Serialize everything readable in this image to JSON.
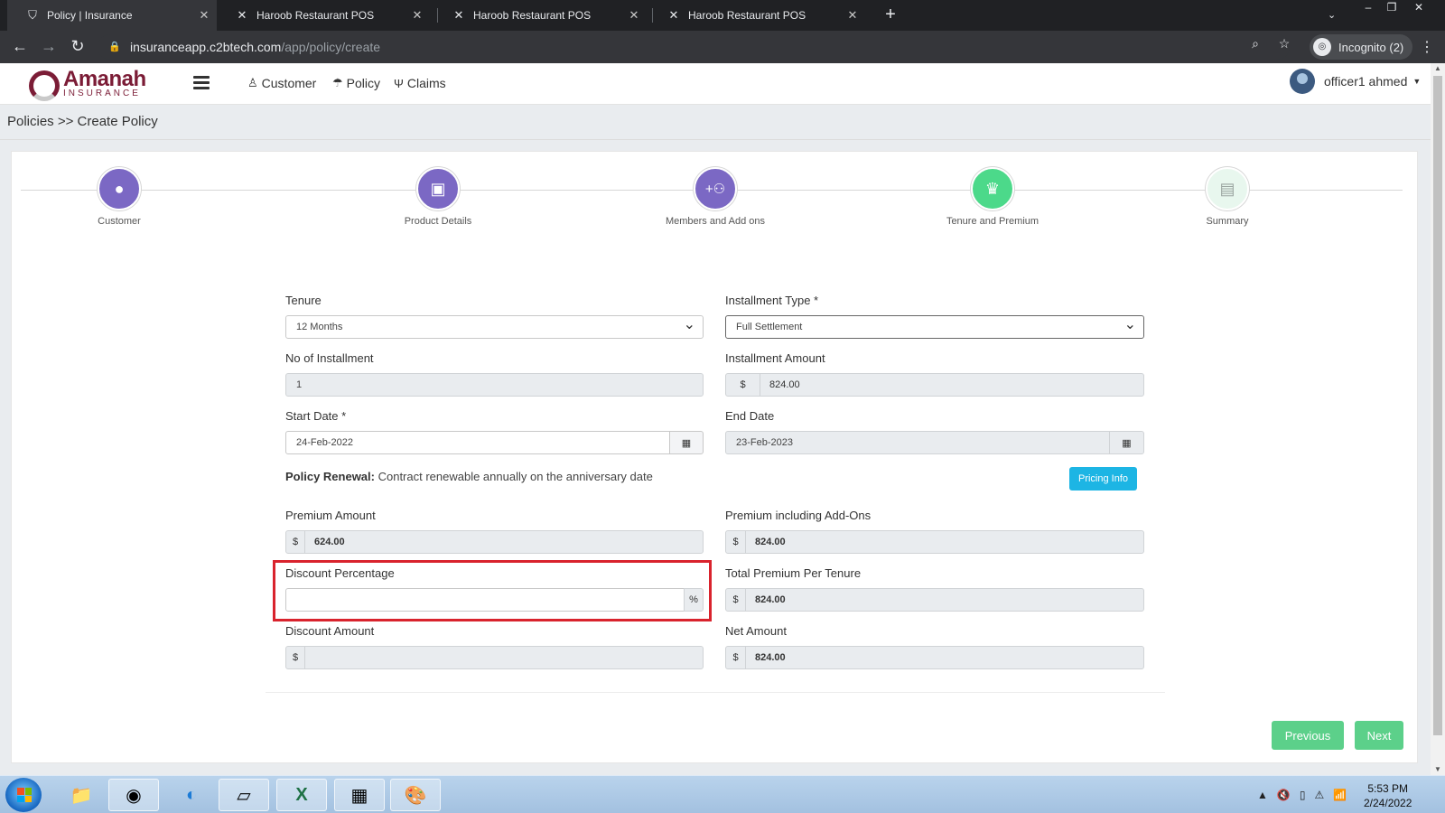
{
  "browser": {
    "tabs": [
      {
        "title": "Policy | Insurance",
        "icon": "shield-icon",
        "active": true
      },
      {
        "title": "Haroob Restaurant POS",
        "icon": "x-logo-icon",
        "active": false
      },
      {
        "title": "Haroob Restaurant POS",
        "icon": "x-logo-icon",
        "active": false
      },
      {
        "title": "Haroob Restaurant POS",
        "icon": "x-logo-icon",
        "active": false
      }
    ],
    "url_host": "insuranceapp.c2btech.com",
    "url_path": "/app/policy/create",
    "incognito_label": "Incognito (2)"
  },
  "app": {
    "logo_text": "Amanah",
    "logo_sub": "INSURANCE",
    "nav": [
      {
        "label": "Customer",
        "icon": "user-icon"
      },
      {
        "label": "Policy",
        "icon": "umbrella-icon"
      },
      {
        "label": "Claims",
        "icon": "claims-icon"
      }
    ],
    "user_name": "officer1 ahmed"
  },
  "breadcrumb": "Policies >> Create Policy",
  "stepper": [
    {
      "label": "Customer",
      "icon": "user-icon",
      "color": "#7b68c4"
    },
    {
      "label": "Product Details",
      "icon": "bag-icon",
      "color": "#7b68c4"
    },
    {
      "label": "Members and Add ons",
      "icon": "add-group-icon",
      "color": "#7b68c4"
    },
    {
      "label": "Tenure and Premium",
      "icon": "crown-icon",
      "color": "#4cd98a"
    },
    {
      "label": "Summary",
      "icon": "document-icon",
      "color": "#e8f7ee"
    }
  ],
  "form": {
    "tenure_label": "Tenure",
    "tenure_value": "12 Months",
    "installment_type_label": "Installment Type *",
    "installment_type_value": "Full Settlement",
    "no_installment_label": "No of Installment",
    "no_installment_value": "1",
    "installment_amount_label": "Installment Amount",
    "installment_amount_value": "824.00",
    "start_date_label": "Start Date *",
    "start_date_value": "24-Feb-2022",
    "end_date_label": "End Date",
    "end_date_value": "23-Feb-2023",
    "renewal_bold": "Policy Renewal:",
    "renewal_text": " Contract renewable annually on the anniversary date",
    "pricing_info_label": "Pricing Info",
    "premium_amount_label": "Premium Amount",
    "premium_amount_value": "624.00",
    "premium_addons_label": "Premium including Add-Ons",
    "premium_addons_value": "824.00",
    "discount_pct_label": "Discount Percentage",
    "discount_pct_value": "",
    "total_premium_label": "Total Premium Per Tenure",
    "total_premium_value": "824.00",
    "discount_amount_label": "Discount Amount",
    "discount_amount_value": "",
    "net_amount_label": "Net Amount",
    "net_amount_value": "824.00",
    "currency": "$",
    "percent": "%"
  },
  "buttons": {
    "previous": "Previous",
    "next": "Next"
  },
  "taskbar": {
    "time": "5:53 PM",
    "date": "2/24/2022"
  }
}
